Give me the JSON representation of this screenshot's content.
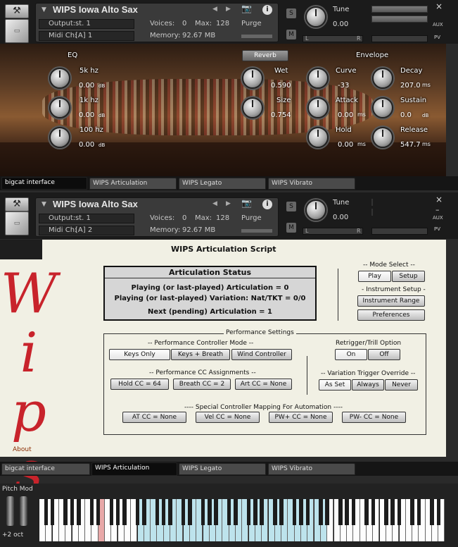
{
  "instrument1": {
    "name": "WIPS Iowa Alto Sax",
    "output_label": "Output:",
    "output_value": "st. 1",
    "voices_label": "Voices:",
    "voices_value": "0",
    "max_label": "Max:",
    "max_value": "128",
    "purge_label": "Purge",
    "midi_label": "Midi Ch:",
    "midi_value": "[A]  1",
    "memory_label": "Memory:",
    "memory_value": "92.67 MB",
    "tune_label": "Tune",
    "tune_value": "0.00",
    "s_label": "S",
    "m_label": "M",
    "pan_left": "L",
    "pan_right": "R"
  },
  "instrument2": {
    "name": "WIPS Iowa Alto Sax",
    "output_label": "Output:",
    "output_value": "st. 1",
    "voices_label": "Voices:",
    "voices_value": "0",
    "max_label": "Max:",
    "max_value": "128",
    "purge_label": "Purge",
    "midi_label": "Midi Ch:",
    "midi_value": "[A]  2",
    "memory_label": "Memory:",
    "memory_value": "92.67 MB",
    "tune_label": "Tune",
    "tune_value": "0.00",
    "s_label": "S",
    "m_label": "M",
    "pan_left": "L",
    "pan_right": "R"
  },
  "side": {
    "close": "×",
    "aux": "AUX",
    "pv": "PV",
    "minus": "–"
  },
  "fx": {
    "eq_title": "EQ",
    "reverb_title": "Reverb",
    "envelope_title": "Envelope",
    "eq1_label": "5k hz",
    "eq1_value": "0.00",
    "eq2_label": "1k hz",
    "eq2_value": "0.00",
    "eq3_label": "100 hz",
    "eq3_value": "0.00",
    "db": "dB",
    "wet_label": "Wet",
    "wet_value": "0.590",
    "size_label": "Size",
    "size_value": "0.754",
    "curve_label": "Curve",
    "curve_value": "-33",
    "attack_label": "Attack",
    "attack_value": "0.00",
    "hold_label": "Hold",
    "hold_value": "0.00",
    "decay_label": "Decay",
    "decay_value": "207.0",
    "sustain_label": "Sustain",
    "sustain_value": "0.0",
    "release_label": "Release",
    "release_value": "547.7",
    "ms": "ms"
  },
  "tabs1": [
    "bigcat interface",
    "WIPS Articulation",
    "WIPS Legato",
    "WIPS Vibrato"
  ],
  "tabs2": [
    "bigcat interface",
    "WIPS Articulation",
    "WIPS Legato",
    "WIPS Vibrato"
  ],
  "script": {
    "title": "WIPS Articulation Script",
    "logo": "Wips",
    "about": "About",
    "status_title": "Articulation Status",
    "status_line1": "Playing (or last-played) Articulation = 0",
    "status_line2": "Playing (or last-played) Variation: Nat/TKT = 0/0",
    "status_line3": "Next (pending) Articulation = 1",
    "mode_select": "-- Mode Select --",
    "play": "Play",
    "setup": "Setup",
    "instrument_setup": "- Instrument Setup -",
    "instrument_range": "Instrument Range",
    "preferences": "Preferences",
    "perf_settings": "Performance Settings",
    "pcm_title": "-- Performance Controller Mode --",
    "keys_only": "Keys Only",
    "keys_breath": "Keys + Breath",
    "wind_controller": "Wind Controller",
    "retrigger_title": "Retrigger/Trill Option",
    "on": "On",
    "off": "Off",
    "cc_title": "-- Performance CC Assignments --",
    "hold_cc": "Hold CC = 64",
    "breath_cc": "Breath CC = 2",
    "art_cc": "Art CC = None",
    "vto_title": "-- Variation Trigger Override --",
    "as_set": "As Set",
    "always": "Always",
    "never": "Never",
    "special_title": "---- Special Controller Mapping For Automation ----",
    "at_cc": "AT CC = None",
    "vel_cc": "Vel CC = None",
    "pwp_cc": "PW+ CC = None",
    "pwm_cc": "PW- CC = None"
  },
  "keyboard": {
    "pitch_mod": "Pitch Mod",
    "octave": "+2 oct"
  }
}
